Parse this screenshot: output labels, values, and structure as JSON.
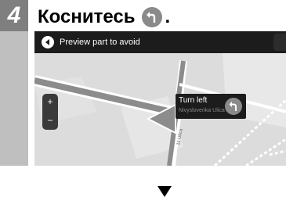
{
  "step": {
    "number": "4",
    "text": "Коснитесь",
    "suffix": "."
  },
  "screen": {
    "title": "Preview part to avoid",
    "zoom": {
      "plus": "+",
      "minus": "−"
    },
    "callout": {
      "title": "Turn left",
      "subtitle": "Nivyslovenka Ulica"
    },
    "street_label": "11 Ulica"
  },
  "colors": {
    "badge": "#7f7f7f",
    "bar": "#1c1c1c",
    "route": "#8c8c8c",
    "map_bg": "#dcdcdc"
  },
  "icons": [
    "turn-left-icon",
    "back-arrow-icon",
    "down-arrow-icon"
  ]
}
